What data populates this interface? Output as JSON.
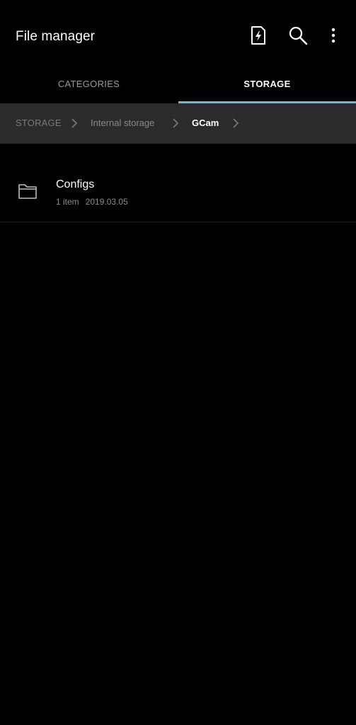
{
  "app_bar": {
    "title": "File manager",
    "actions": [
      {
        "name": "clean-storage",
        "icon": "lightning-file-icon"
      },
      {
        "name": "search",
        "icon": "search-icon"
      },
      {
        "name": "more-options",
        "icon": "more-vert-icon"
      }
    ]
  },
  "tabs": [
    {
      "label": "CATEGORIES",
      "selected": false
    },
    {
      "label": "STORAGE",
      "selected": true
    }
  ],
  "breadcrumb": [
    {
      "label": "STORAGE"
    },
    {
      "label": "Internal storage"
    },
    {
      "label": "GCam",
      "current": true
    }
  ],
  "files": [
    {
      "name": "Configs",
      "type": "folder",
      "count": "1 item",
      "date": "2019.03.05"
    }
  ],
  "colors": {
    "background": "#000000",
    "breadcrumb_bg": "#2b2b2b",
    "tab_indicator": "#7fb2c8",
    "text_primary": "#ffffff",
    "text_secondary": "#8c8c8c"
  }
}
